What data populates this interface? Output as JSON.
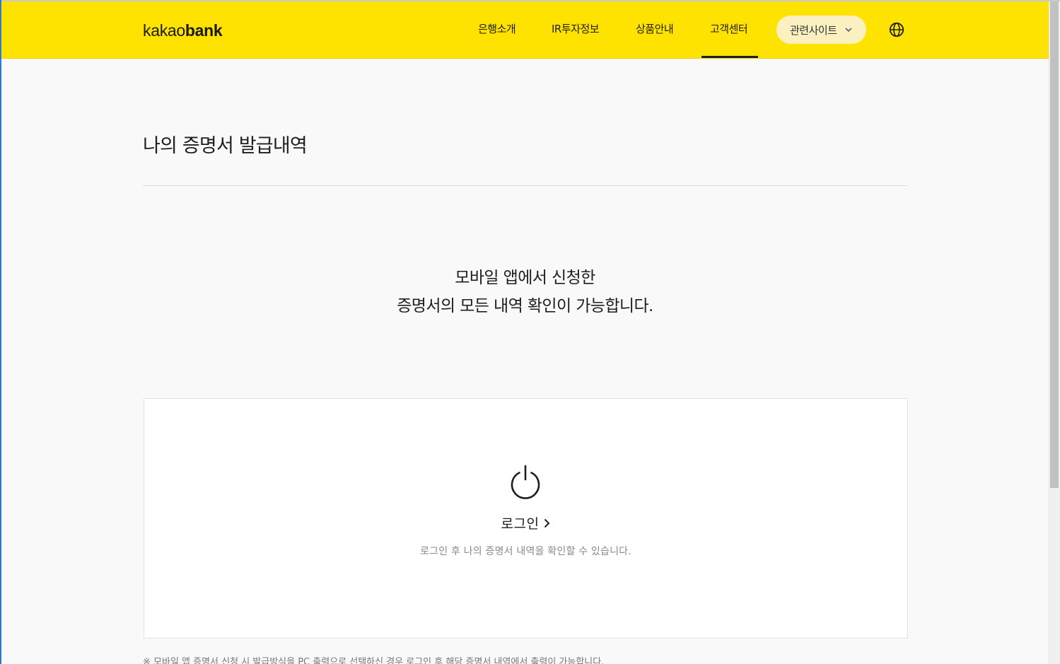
{
  "header": {
    "logo_light": "kakao",
    "logo_bold": "bank",
    "nav": [
      {
        "label": "은행소개"
      },
      {
        "label": "IR투자정보"
      },
      {
        "label": "상품안내"
      },
      {
        "label": "고객센터"
      }
    ],
    "related_sites_label": "관련사이트",
    "active_nav": "고객센터"
  },
  "main": {
    "title": "나의 증명서 발급내역",
    "intro_line1": "모바일 앱에서 신청한",
    "intro_line2": "증명서의 모든 내역 확인이 가능합니다.",
    "login_card": {
      "icon": "power-icon",
      "login_label": "로그인",
      "description": "로그인 후 나의 증명서 내역을 확인할 수 있습니다."
    },
    "notice": "※ 모바일 앱 증명서 신청 시 발급방식을 PC 출력으로 선택하신 경우 로그인 후 해당 증명서 내역에서 출력이 가능합니다."
  },
  "colors": {
    "brand_yellow": "#ffe300",
    "text_primary": "#1e1e1e",
    "text_muted": "#8a8a8a",
    "related_btn_bg": "#fbf0c0"
  }
}
